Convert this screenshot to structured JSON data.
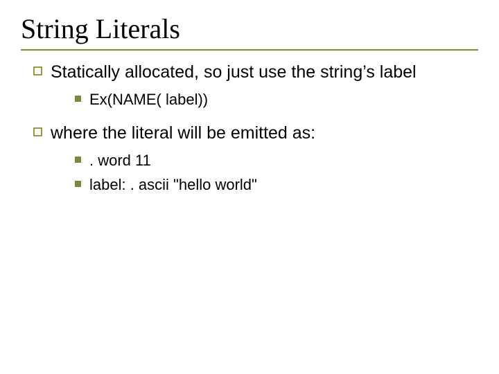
{
  "title": "String Literals",
  "points": [
    {
      "text": "Statically allocated, so just use the string’s label",
      "sub": [
        "Ex(NAME( label))"
      ]
    },
    {
      "text": "where the literal will be emitted as:",
      "sub": [
        ". word 11",
        "label: . ascii \"hello world\""
      ]
    }
  ]
}
